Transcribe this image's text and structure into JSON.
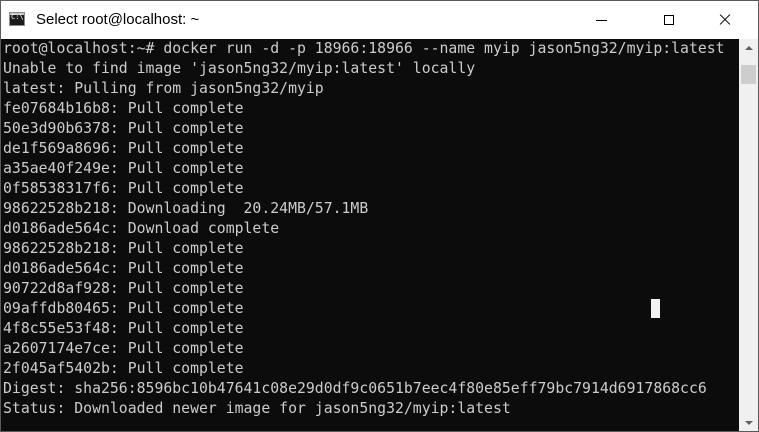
{
  "window": {
    "title": "Select root@localhost: ~",
    "icon": "terminal-icon",
    "icon_glyph": "C:\\",
    "controls": {
      "minimize": "minimize-icon",
      "maximize": "maximize-icon",
      "close": "close-icon"
    }
  },
  "colors": {
    "console_bg": "#0c0c0c",
    "console_fg": "#cccccc",
    "titlebar_bg": "#ffffff",
    "cursor": "#f2f2f2"
  },
  "console": {
    "lines": [
      "root@localhost:~# docker run -d -p 18966:18966 --name myip jason5ng32/myip:latest",
      "Unable to find image 'jason5ng32/myip:latest' locally",
      "latest: Pulling from jason5ng32/myip",
      "fe07684b16b8: Pull complete",
      "50e3d90b6378: Pull complete",
      "de1f569a8696: Pull complete",
      "a35ae40f249e: Pull complete",
      "0f58538317f6: Pull complete",
      "98622528b218: Downloading  20.24MB/57.1MB",
      "d0186ade564c: Download complete",
      "98622528b218: Pull complete",
      "d0186ade564c: Pull complete",
      "90722d8af928: Pull complete",
      "09affdb80465: Pull complete",
      "4f8c55e53f48: Pull complete",
      "a2607174e7ce: Pull complete",
      "2f045af5402b: Pull complete",
      "Digest: sha256:8596bc10b47641c08e29d0df9c0651b7eec4f80e85eff79bc7914d6917868cc6",
      "Status: Downloaded newer image for jason5ng32/myip:latest"
    ]
  }
}
